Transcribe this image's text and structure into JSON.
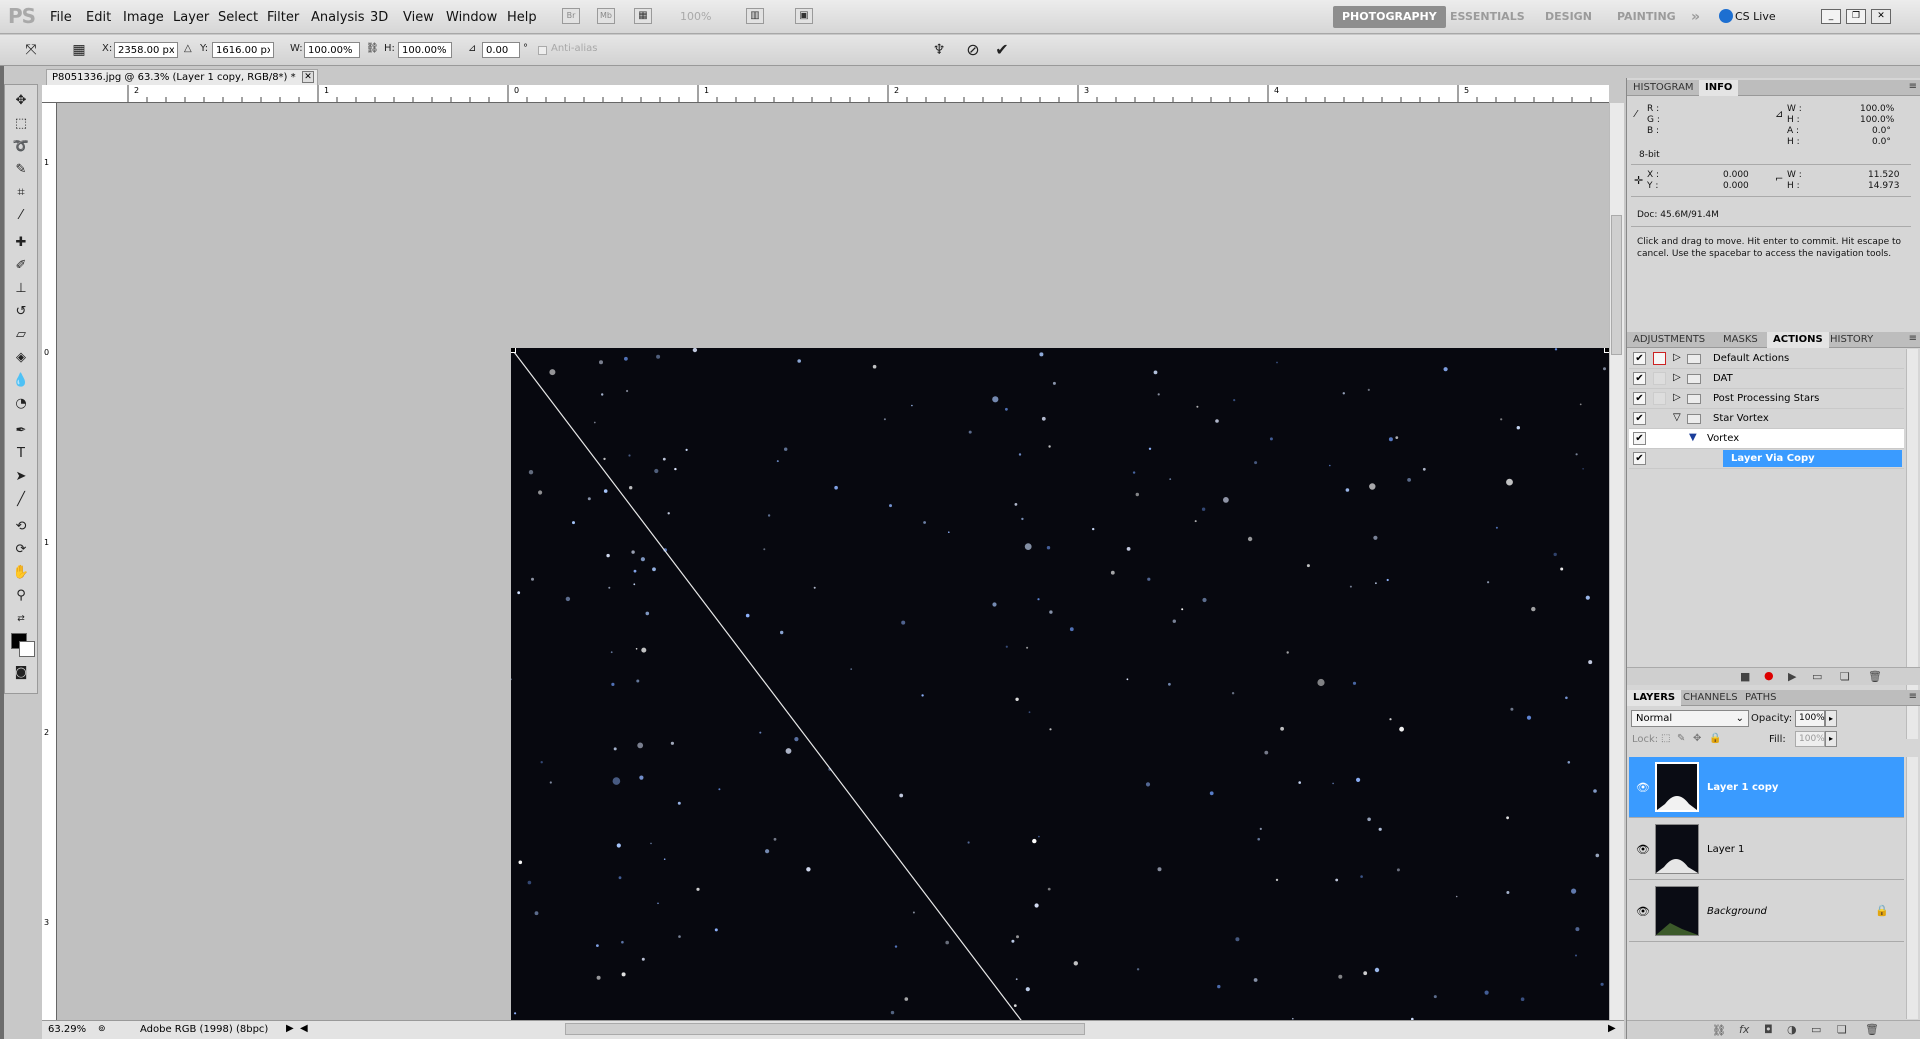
{
  "app": {
    "logo": "PS"
  },
  "menu": [
    "File",
    "Edit",
    "Image",
    "Layer",
    "Select",
    "Filter",
    "Analysis",
    "3D",
    "View",
    "Window",
    "Help"
  ],
  "menubar_icons": {
    "bridge": "Br",
    "minibridge": "Mb"
  },
  "zoom_dropdown": "100%",
  "workspaces": [
    "PHOTOGRAPHY",
    "ESSENTIALS",
    "DESIGN",
    "PAINTING"
  ],
  "workspace_more": "»",
  "cs_live": "CS Live",
  "options": {
    "x_label": "X:",
    "x_value": "2358.00 px",
    "y_label": "Y:",
    "y_value": "1616.00 px",
    "w_label": "W:",
    "w_value": "100.00%",
    "h_label": "H:",
    "h_value": "100.00%",
    "angle_value": "0.00",
    "angle_unit": "°",
    "antialias": "Anti-alias"
  },
  "document": {
    "tab_title": "P8051336.jpg @ 63.3% (Layer 1 copy, RGB/8*) *",
    "zoom_status": "63.29%",
    "profile": "Adobe RGB (1998) (8bpc)"
  },
  "rulers": {
    "h_ticks": [
      "2",
      "1",
      "0",
      "1",
      "2",
      "3",
      "4",
      "5"
    ],
    "v_ticks": [
      "1",
      "0",
      "1",
      "2",
      "3"
    ]
  },
  "info_panel": {
    "tabs": [
      "HISTOGRAM",
      "INFO"
    ],
    "active_tab": "INFO",
    "rgb_labels": [
      "R :",
      "G :",
      "B :"
    ],
    "bit_depth": "8-bit",
    "pct_labels": [
      "W :",
      "H :",
      "A :",
      "H :"
    ],
    "pct_values": [
      "100.0%",
      "100.0%",
      "0.0°",
      "0.0°"
    ],
    "xy_labels": [
      "X :",
      "Y :"
    ],
    "xy_values": [
      "0.000",
      "0.000"
    ],
    "wh_labels": [
      "W :",
      "H :"
    ],
    "wh_values": [
      "11.520",
      "14.973"
    ],
    "doc_size": "Doc: 45.6M/91.4M",
    "hint": "Click and drag to move. Hit enter to commit. Hit escape to cancel. Use the spacebar to access the navigation tools."
  },
  "actions_panel": {
    "tabs": [
      "ADJUSTMENTS",
      "MASKS",
      "ACTIONS",
      "HISTORY"
    ],
    "active_tab": "ACTIONS",
    "rows": [
      {
        "label": "Default Actions",
        "type": "set",
        "expanded": false
      },
      {
        "label": "DAT",
        "type": "set",
        "expanded": false
      },
      {
        "label": "Post Processing Stars",
        "type": "set",
        "expanded": false
      },
      {
        "label": "Star Vortex",
        "type": "set",
        "expanded": true
      },
      {
        "label": "Vortex",
        "type": "action",
        "expanded": true
      },
      {
        "label": "Layer Via Copy",
        "type": "step",
        "selected": true
      }
    ]
  },
  "layers_panel": {
    "tabs": [
      "LAYERS",
      "CHANNELS",
      "PATHS"
    ],
    "active_tab": "LAYERS",
    "blend_mode": "Normal",
    "opacity_label": "Opacity:",
    "opacity": "100%",
    "lock_label": "Lock:",
    "fill_label": "Fill:",
    "fill": "100%",
    "layers": [
      {
        "name": "Layer 1 copy",
        "selected": true
      },
      {
        "name": "Layer 1",
        "selected": false
      },
      {
        "name": "Background",
        "selected": false,
        "locked": true
      }
    ]
  },
  "colors": {
    "accent": "#3a9bff",
    "photo_bg": "#07080f",
    "workspace_active": "#8e8e8e"
  }
}
